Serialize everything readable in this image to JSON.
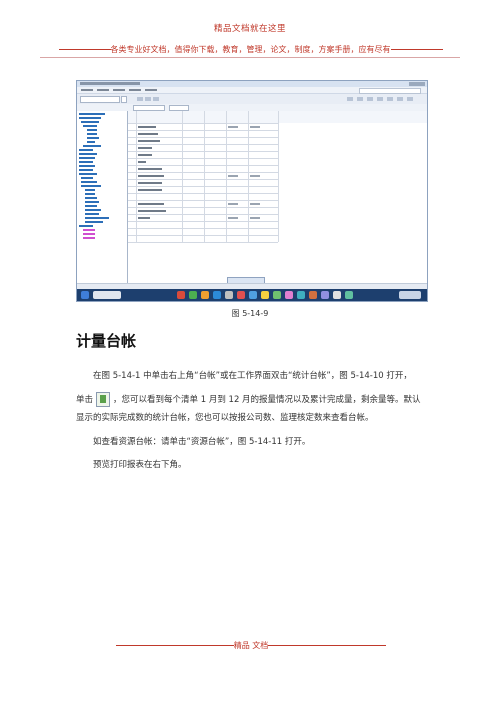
{
  "header": {
    "top": "精品文档就在这里",
    "line_text": "各类专业好文档，值得你下载，教育，管理，论文，制度，方案手册，应有尽有"
  },
  "figure": {
    "caption": "图 5-14-9"
  },
  "section": {
    "title": "计量台帐"
  },
  "paragraphs": {
    "p1": "在图 5-14-1 中单击右上角“台帐”或在工作界面双击“统计台帐”，图 5-14-10 打开，",
    "p2_a": "单击",
    "p2_b": "，您可以看到每个清单 1 月到 12 月的报量情况以及累计完成量，剩余量等。默认显示的实际完成数的统计台帐，您也可以按报公司数、监理核定数来查看台帐。",
    "p3": "如查看资源台帐：请单击“资源台帐”，图 5-14-11 打开。",
    "p4": "预览打印报表在右下角。"
  },
  "footer": {
    "text": "精品  文档"
  },
  "colors": {
    "header_red": "#c0392b",
    "taskbar": "#1d3f6e"
  }
}
